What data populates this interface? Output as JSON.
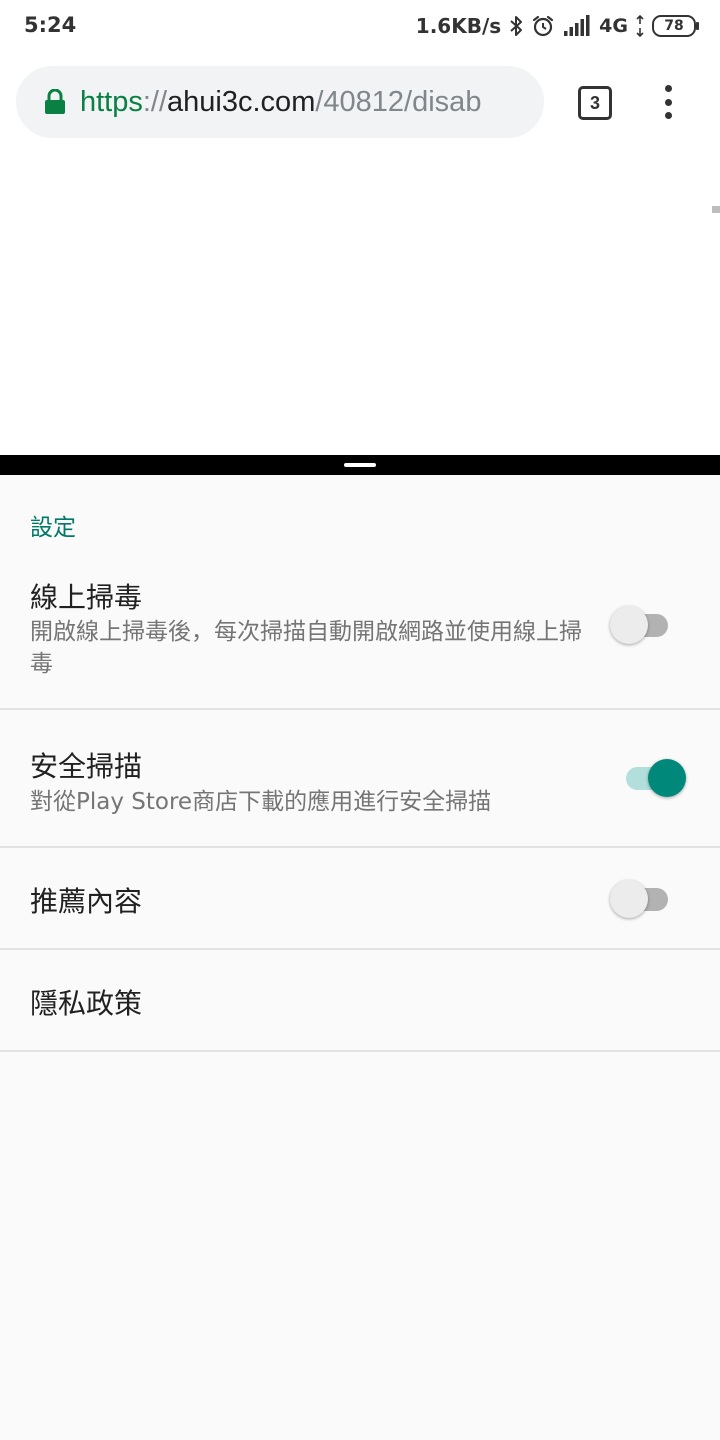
{
  "status_bar": {
    "time": "5:24",
    "net_speed": "1.6KB/s",
    "network_type": "4G",
    "battery": "78",
    "icons": [
      "bluetooth-icon",
      "alarm-icon",
      "signal-icon"
    ]
  },
  "browser": {
    "url_scheme": "https",
    "url_separator": "://",
    "url_host": "ahui3c.com",
    "url_path": "/40812/disab",
    "tab_count": "3",
    "secure_color": "#0b8043"
  },
  "settings": {
    "section_header": "設定",
    "accent_color": "#00897b",
    "items": [
      {
        "title": "線上掃毒",
        "subtitle": "開啟線上掃毒後，每次掃描自動開啟網路並使用線上掃毒",
        "toggle": "off"
      },
      {
        "title": "安全掃描",
        "subtitle": "對從Play Store商店下載的應用進行安全掃描",
        "toggle": "on"
      },
      {
        "title": "推薦內容",
        "toggle": "off"
      },
      {
        "title": "隱私政策"
      }
    ]
  }
}
